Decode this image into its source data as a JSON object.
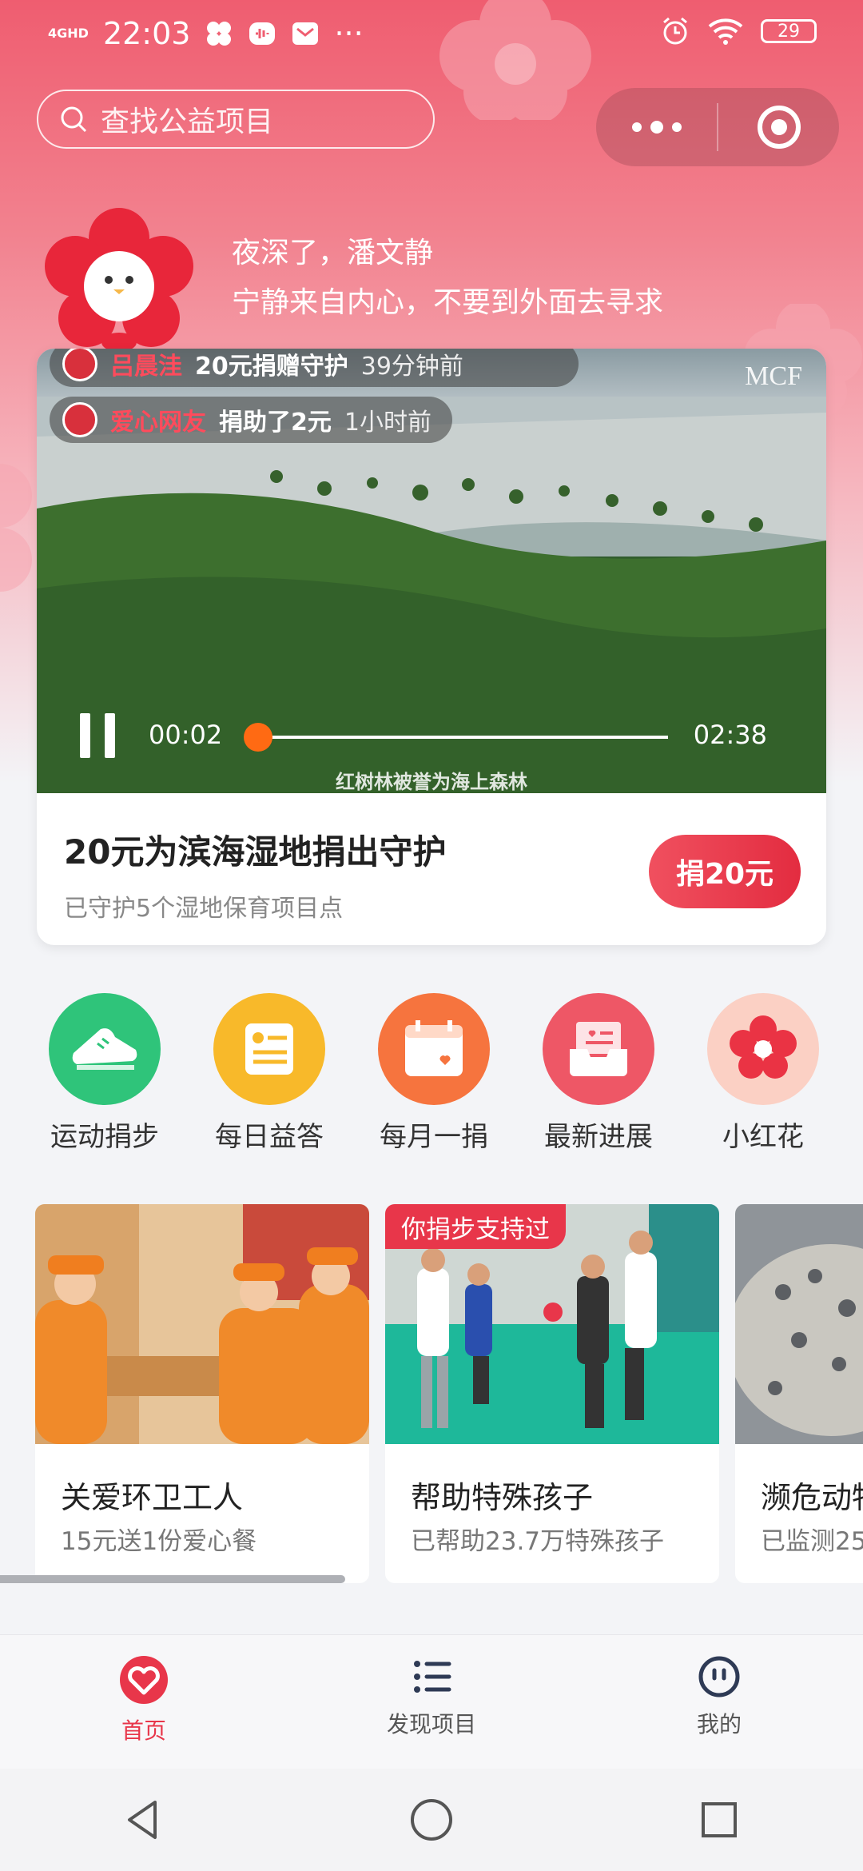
{
  "status_bar": {
    "network": "4GHD",
    "time": "22:03",
    "battery": "29"
  },
  "header": {
    "search_placeholder": "查找公益项目",
    "greeting_line1": "夜深了，潘文静",
    "greeting_line2": "宁静来自内心，不要到外面去寻求"
  },
  "video_card": {
    "ticker": [
      {
        "name": "吕晨洼",
        "action": "20元捐赠守护",
        "time": "39分钟前"
      },
      {
        "name": "爱心网友",
        "action": "捐助了2元",
        "time": "1小时前"
      }
    ],
    "brand": "MCF",
    "current_time": "00:02",
    "duration": "02:38",
    "progress": 0.013,
    "caption": "红树林被誉为海上森林",
    "title": "20元为滨海湿地捐出守护",
    "subtitle": "已守护5个湿地保育项目点",
    "donate_label": "捐20元"
  },
  "entries": [
    {
      "label": "运动捐步",
      "icon": "sneaker-icon",
      "color": "#2fc47a"
    },
    {
      "label": "每日益答",
      "icon": "quiz-card-icon",
      "color": "#f8b92a"
    },
    {
      "label": "每月一捐",
      "icon": "calendar-icon",
      "color": "#f6743e"
    },
    {
      "label": "最新进展",
      "icon": "inbox-icon",
      "color": "#ee5766"
    },
    {
      "label": "小红花",
      "icon": "flower-icon",
      "color": "#fbd0c4"
    }
  ],
  "projects": [
    {
      "title": "关爱环卫工人",
      "subtitle": "15元送1份爱心餐",
      "tag": ""
    },
    {
      "title": "帮助特殊孩子",
      "subtitle": "已帮助23.7万特殊孩子",
      "tag": "你捐步支持过"
    },
    {
      "title": "濒危动物",
      "subtitle": "已监测25",
      "tag": ""
    }
  ],
  "tabs": [
    {
      "label": "首页",
      "icon": "heart-home-icon",
      "active": true
    },
    {
      "label": "发现项目",
      "icon": "list-icon",
      "active": false
    },
    {
      "label": "我的",
      "icon": "profile-face-icon",
      "active": false
    }
  ],
  "colors": {
    "accent": "#e8364a",
    "header_gradient_top": "#ef5d70",
    "progress_knob": "#ff6a13"
  }
}
